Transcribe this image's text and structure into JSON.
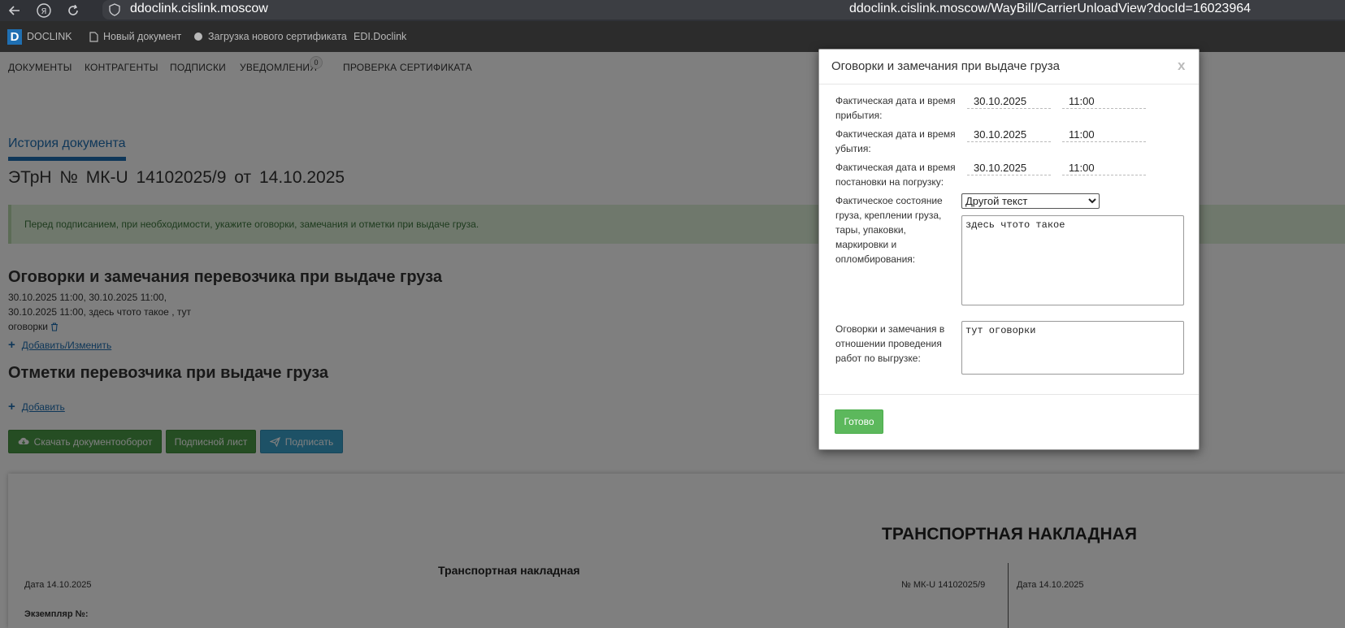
{
  "browser": {
    "url_host": "ddoclink.cislink.moscow",
    "url_full": "ddoclink.cislink.moscow/WayBill/CarrierUnloadView?docId=16023964",
    "icons": [
      "back-arrow-icon",
      "yandex-icon",
      "refresh-icon",
      "shield-icon"
    ]
  },
  "header": {
    "logo_letter": "D",
    "logo_text": "DOCLINK",
    "new_doc": "Новый документ",
    "load_cert": "Загрузка нового сертификата",
    "edi": "EDI.Doclink"
  },
  "nav": {
    "documents": "ДОКУМЕНТЫ",
    "contractors": "КОНТРАГЕНТЫ",
    "subscriptions": "ПОДПИСКИ",
    "notifications": "УВЕДОМЛЕНИЯ",
    "notifications_count": "0",
    "check_cert": "ПРОВЕРКА СЕРТИФИКАТА"
  },
  "main": {
    "history_tab": "История документа",
    "doc_title": "ЭТрН №   МК-U 14102025/9  от   14.10.2025",
    "info": "Перед подписанием, при необходимости, укажите оговорки, замечания и отметки при выдаче груза.",
    "remarks_title": "Оговорки и замечания перевозчика при выдаче груза",
    "remarks_line1": "30.10.2025  11:00, 30.10.2025  11:00,",
    "remarks_line2": "30.10.2025  11:00, здесь чтото такое , тут",
    "remarks_line3": "оговорки",
    "add_edit_link": "Добавить/Изменить",
    "marks_title": "Отметки перевозчика при выдаче груза",
    "add_link": "Добавить",
    "btn_download": "Скачать документооборот",
    "btn_sign_sheet": "Подписной лист",
    "btn_sign": "Подписать"
  },
  "document": {
    "big_title": "ТРАНСПОРТНАЯ НАКЛАДНАЯ",
    "sub_title": "Транспортная накладная",
    "date_left": "Дата  14.10.2025",
    "number": "№   МК-U 14102025/9",
    "date_right": "Дата 14.10.2025",
    "copy_no": "Экземпляр №:"
  },
  "modal": {
    "title": "Оговорки и замечания при выдаче груза",
    "close": "x",
    "arrival_label": "Фактическая дата и время прибытия:",
    "arrival_date": "30.10.2025",
    "arrival_time": "11:00",
    "departure_label": "Фактическая дата и время убытия:",
    "departure_date": "30.10.2025",
    "departure_time": "11:00",
    "loading_label": "Фактическая дата и время постановки на погрузку:",
    "loading_date": "30.10.2025",
    "loading_time": "11:00",
    "condition_label": "Фактическое состояние груза, креплении груза, тары, упаковки, маркировки и опломбирования:",
    "condition_select": "Другой текст",
    "condition_text": "здесь чтото такое",
    "remarks_label": "Оговорки и замечания в отношении проведения работ по выгрузке:",
    "remarks_text": "тут оговорки",
    "done_button": "Готово"
  }
}
